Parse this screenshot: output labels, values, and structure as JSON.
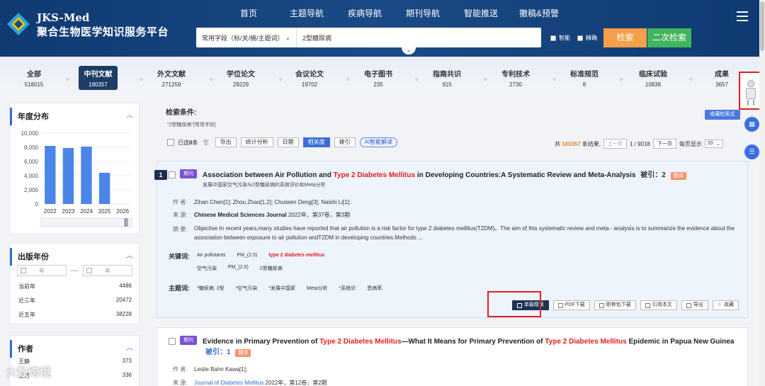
{
  "brand": {
    "name_en": "JKS-Med",
    "name_cn": "聚合生物医学知识服务平台"
  },
  "nav": [
    "首页",
    "主题导航",
    "疾病导航",
    "期刊导航",
    "智能推送",
    "撤稿&预警"
  ],
  "search": {
    "field": "常用字段（标/关/摘/主题词）",
    "value": "2型糖尿病",
    "opt_smart": "智能",
    "opt_exact": "精确",
    "search_label": "检索",
    "secondary_label": "二次检索"
  },
  "categories": [
    {
      "name": "全部",
      "count": "518015"
    },
    {
      "name": "中刊文献",
      "count": "180357"
    },
    {
      "name": "外文文献",
      "count": "271259"
    },
    {
      "name": "学位论文",
      "count": "29229"
    },
    {
      "name": "会议论文",
      "count": "19702"
    },
    {
      "name": "电子图书",
      "count": "235"
    },
    {
      "name": "指南共识",
      "count": "915"
    },
    {
      "name": "专利技术",
      "count": "2730"
    },
    {
      "name": "标准规范",
      "count": "8"
    },
    {
      "name": "临床试验",
      "count": "10838"
    },
    {
      "name": "成果",
      "count": "3657"
    }
  ],
  "year_panel": {
    "title": "年度分布",
    "chart_data": {
      "type": "bar",
      "categories": [
        "2022",
        "2023",
        "2024",
        "2025",
        "2026"
      ],
      "values": [
        8200,
        7900,
        8100,
        4400,
        0
      ],
      "ylim": [
        0,
        10000
      ],
      "yticks": [
        "0",
        "2,000",
        "4,000",
        "6,000",
        "8,000",
        "10,000"
      ],
      "bar_color": "#4a86e8"
    }
  },
  "pub_year_panel": {
    "title": "出版年份",
    "from_placeholder": "年",
    "to_placeholder": "年",
    "rows": [
      {
        "label": "当前年",
        "count": "4486"
      },
      {
        "label": "近三年",
        "count": "20472"
      },
      {
        "label": "近五年",
        "count": "38228"
      }
    ]
  },
  "author_panel": {
    "title": "作者",
    "rows": [
      {
        "label": "王静",
        "count": "373"
      },
      {
        "label": "王芳",
        "count": "336"
      }
    ]
  },
  "conditions": {
    "title": "检索条件:",
    "value": "\"2型糖尿病\"[常用字段]",
    "save_label": "收藏检索式"
  },
  "toolbar": {
    "selected_prefix": "已选",
    "selected_count": "0",
    "selected_suffix": "条",
    "export": "导出",
    "stats": "统计分析",
    "date": "日期",
    "relevance": "相关度",
    "cited": "被引",
    "ai": "AI智能解读"
  },
  "pager": {
    "total_prefix": "共",
    "total": "180357",
    "total_suffix": "条结果,",
    "prev": "上一页",
    "page": "1 / 9018",
    "next": "下一页",
    "per_page_label": "每页显示",
    "per_page": "20"
  },
  "results": [
    {
      "num": "1",
      "tag": "期刊",
      "title_pre": "Association between Air Pollution and ",
      "title_hl": "Type 2 Diabetes Mellitus",
      "title_post": " in Developing Countries:A Systematic Review and Meta-Analysis",
      "cite_label": "被引：2",
      "translate": "翻译",
      "subtitle": "发展中国家空气污染与2型糖尿病的系统评价和Meta分析",
      "author_label": "作 者:",
      "authors": "Zihan Chen[1];  Zhou Zhao[1,2];  Chuiwen Deng[3];  Naishi Li[1];",
      "source_label": "来 源:",
      "journal": "Chinese Medical Sciences Journal",
      "source_detail": " 2022年，第37卷，第3期",
      "abstract_label": "摘 要:",
      "abstract": "Objective In recent years,many studies have reported that air pollution is a risk factor for type 2 diabetes mellitus(T2DM)。The aim of this systematic review and meta - analysis is to summarize the evidence about the association between exposure to air pollution andT2DM in developing countries.Methods ...",
      "keywords_label": "关键词:",
      "keywords1": [
        "Air pollutants",
        "PM_(2.5)"
      ],
      "keyword_hl": "type 2 diabetes mellitus",
      "keywords2": [
        "空气污染",
        "PM_(2.5)",
        "2型糖尿病"
      ],
      "subjects_label": "主题词:",
      "subjects": [
        "*糖尿病, 2型",
        "*空气污染",
        "*发展中国家",
        "Meta分析",
        "*系统论",
        "患病率"
      ],
      "actions": [
        "单篇精读",
        "PDF下载",
        "职称包下载",
        "引用本文",
        "导出",
        "收藏"
      ]
    },
    {
      "tag": "期刊",
      "title_pre": "Evidence in Primary Prevention of ",
      "title_hl": "Type 2 Diabetes Mellitus",
      "title_mid": "—What It Means for Primary Prevention of ",
      "title_hl2": "Type 2 Diabetes Mellitus",
      "title_post": " Epidemic in Papua New Guinea",
      "cite_label": "被引：1",
      "translate": "翻译",
      "author_label": "作 者:",
      "authors": "Leslie Bahn Kawa[1];",
      "source_label": "来 源:",
      "journal": "Journal of Diabetes Mellitus",
      "source_detail": " 2022年，第12卷，第2期"
    }
  ],
  "watermark": "大数跨境"
}
